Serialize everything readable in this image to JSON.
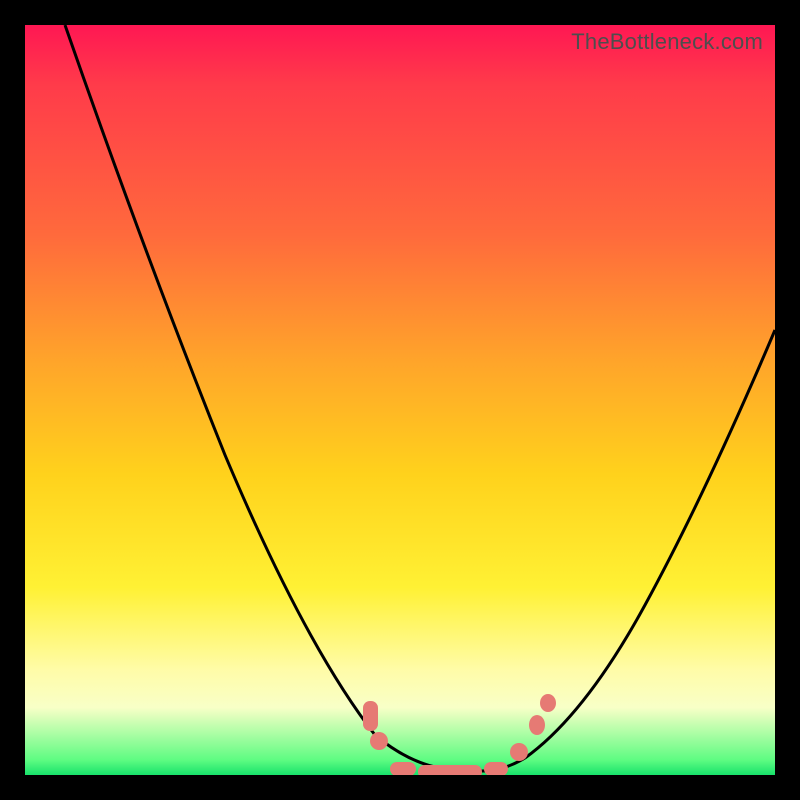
{
  "attribution": "TheBottleneck.com",
  "chart_data": {
    "type": "line",
    "title": "",
    "xlabel": "",
    "ylabel": "",
    "xlim": [
      0,
      100
    ],
    "ylim": [
      0,
      100
    ],
    "grid": false,
    "legend": false,
    "background": "vertical red-to-green gradient (bottleneck heatmap)",
    "series": [
      {
        "name": "bottleneck-curve",
        "description": "V-shaped curve; high (bad/red) at edges, dips to ~0 (good/green) near x≈55",
        "x": [
          0,
          5,
          10,
          15,
          20,
          25,
          30,
          35,
          40,
          45,
          50,
          55,
          60,
          65,
          70,
          75,
          80,
          85,
          90,
          95,
          100
        ],
        "values": [
          100,
          90,
          80,
          69,
          58,
          47,
          37,
          27,
          18,
          10,
          4,
          0,
          3,
          8,
          14,
          21,
          28,
          35,
          43,
          51,
          60
        ]
      }
    ],
    "markers": {
      "description": "Highlighted data points near the trough (the 'sweet spot')",
      "points": [
        {
          "x": 46,
          "y": 8,
          "shape": "tall-pill"
        },
        {
          "x": 48,
          "y": 4,
          "shape": "dot"
        },
        {
          "x": 50,
          "y": 1,
          "shape": "wide-pill"
        },
        {
          "x": 55,
          "y": 0,
          "shape": "wide-pill"
        },
        {
          "x": 60,
          "y": 1,
          "shape": "wide-pill"
        },
        {
          "x": 63,
          "y": 3,
          "shape": "dot"
        },
        {
          "x": 66,
          "y": 8,
          "shape": "dot"
        },
        {
          "x": 68,
          "y": 11,
          "shape": "dot"
        }
      ]
    }
  }
}
